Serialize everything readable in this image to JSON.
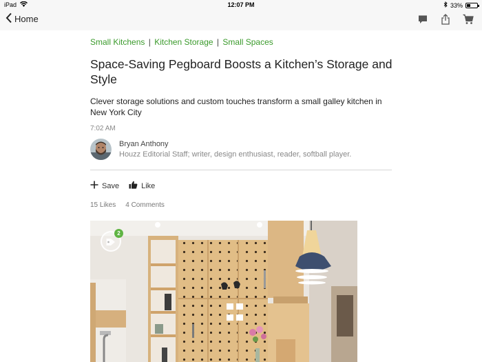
{
  "status_bar": {
    "device": "iPad",
    "time": "12:07 PM",
    "battery": "33%",
    "battery_level": 0.33
  },
  "nav": {
    "back_label": "Home",
    "icons": [
      "comment-icon",
      "share-icon",
      "cart-icon"
    ]
  },
  "article": {
    "tags": [
      "Small Kitchens",
      "Kitchen Storage",
      "Small Spaces"
    ],
    "tag_separator": "|",
    "title": "Space-Saving Pegboard Boosts a Kitchen’s Storage and Style",
    "subtitle": "Clever storage solutions and custom touches transform a small galley kitchen in New York City",
    "time": "7:02 AM",
    "author": {
      "name": "Bryan Anthony",
      "bio": "Houzz Editorial Staff; writer, design enthusiast, reader, softball player."
    },
    "actions": {
      "save": "Save",
      "like": "Like"
    },
    "counts": {
      "likes": "15 Likes",
      "comments": "4 Comments"
    },
    "photo": {
      "tag_count": "2"
    }
  },
  "colors": {
    "accent": "#3a9a2b",
    "badge": "#5fb443"
  }
}
